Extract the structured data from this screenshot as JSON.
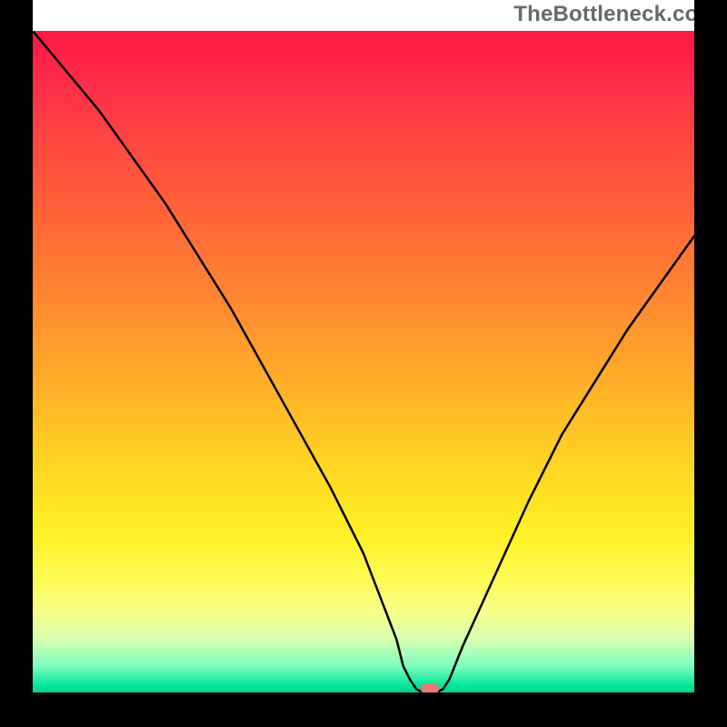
{
  "attribution": "TheBottleneck.com",
  "chart_data": {
    "type": "line",
    "title": "",
    "xlabel": "",
    "ylabel": "",
    "xlim": [
      0,
      100
    ],
    "ylim": [
      0,
      100
    ],
    "x": [
      0,
      5,
      10,
      15,
      20,
      25,
      30,
      35,
      40,
      45,
      50,
      55,
      56,
      57,
      58,
      59,
      60,
      61,
      62,
      63,
      65,
      70,
      75,
      80,
      85,
      90,
      95,
      100
    ],
    "values": [
      100,
      94,
      88,
      81,
      74,
      66,
      58,
      49,
      40,
      31,
      21,
      8,
      4,
      2,
      0.5,
      0,
      0,
      0,
      0.5,
      2,
      7,
      18,
      29,
      39,
      47,
      55,
      62,
      69
    ],
    "optimum_x": 60,
    "background_gradient": {
      "top": "#ff1744",
      "mid": "#ffd622",
      "bottom": "#00d48a"
    },
    "marker_color": "#e77a7a"
  }
}
